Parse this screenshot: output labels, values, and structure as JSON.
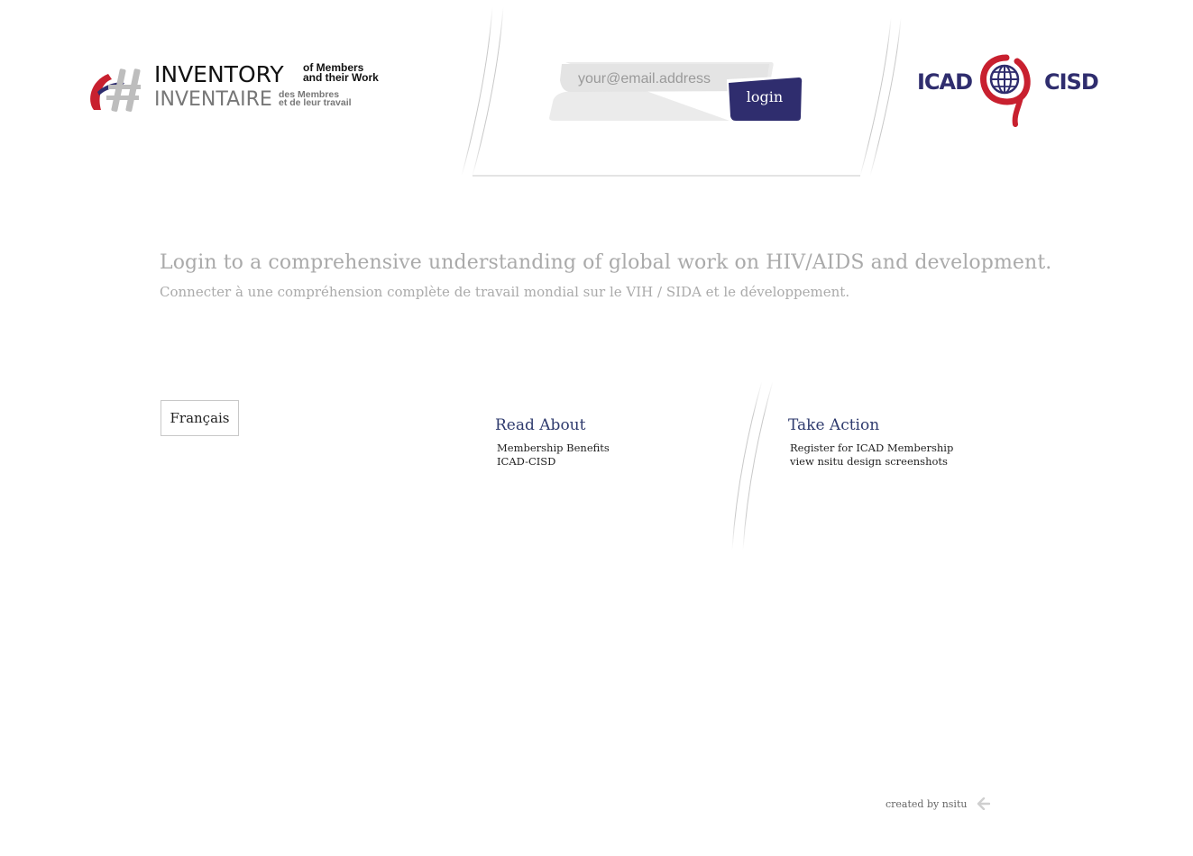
{
  "header": {
    "logo": {
      "en_title": "INVENTORY",
      "en_sub_line1": "of Members",
      "en_sub_line2": "and their Work",
      "fr_title": "INVENTAIRE",
      "fr_sub_line1": "des Membres",
      "fr_sub_line2": "et de leur travail"
    },
    "login": {
      "email_placeholder": "your@email.address",
      "email_value": "",
      "button_label": "login"
    },
    "partner_logo": {
      "left_word": "ICAD",
      "right_word": "CISD"
    }
  },
  "main": {
    "headline_en": "Login to a comprehensive understanding of global work on HIV/AIDS and development.",
    "headline_fr": "Connecter à une compréhension complète de travail mondial sur le VIH / SIDA et le développement.",
    "language_button": "Français",
    "read_about": {
      "title": "Read About",
      "links": [
        "Membership Benefits",
        "ICAD-CISD"
      ]
    },
    "take_action": {
      "title": "Take Action",
      "links": [
        "Register for ICAD Membership",
        "view nsitu design screenshots"
      ]
    }
  },
  "footer": {
    "credit": "created by nsitu"
  },
  "colors": {
    "brand_navy": "#2f2d6e",
    "brand_red": "#c8202f",
    "input_gray": "#e6e6e6",
    "headline_gray": "#aaaaaa"
  },
  "icons": [
    "inventory-logo-icon",
    "icad-ribbon-globe-icon",
    "nsitu-arrow-icon"
  ]
}
